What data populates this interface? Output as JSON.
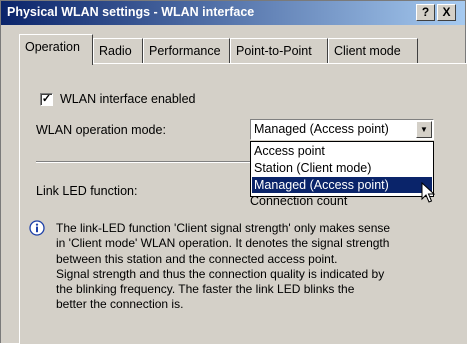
{
  "window": {
    "title": "Physical WLAN settings - WLAN interface",
    "help_btn": "?",
    "close_btn": "X"
  },
  "tabs": [
    {
      "label": "Operation"
    },
    {
      "label": "Radio"
    },
    {
      "label": "Performance"
    },
    {
      "label": "Point-to-Point"
    },
    {
      "label": "Client mode"
    }
  ],
  "operation": {
    "checkbox_label": "WLAN interface enabled",
    "checkbox_checked": true,
    "mode_label": "WLAN operation mode:",
    "mode_value": "Managed (Access point)",
    "mode_options": [
      "Access point",
      "Station (Client mode)",
      "Managed (Access point)"
    ],
    "led_label": "Link LED function:",
    "led_value_partial": "Connection count",
    "info_lines": [
      "The link-LED function 'Client signal strength' only makes sense",
      "in 'Client mode' WLAN operation. It denotes the signal strength",
      "between this station and the connected access point.",
      "Signal strength and thus the connection quality is indicated by",
      "the blinking frequency. The faster the link LED blinks the",
      "better the connection is."
    ]
  },
  "colors": {
    "titlebar_start": "#0a246a",
    "titlebar_end": "#a6caf0",
    "selection": "#0a246a",
    "face": "#d4d0c8"
  }
}
